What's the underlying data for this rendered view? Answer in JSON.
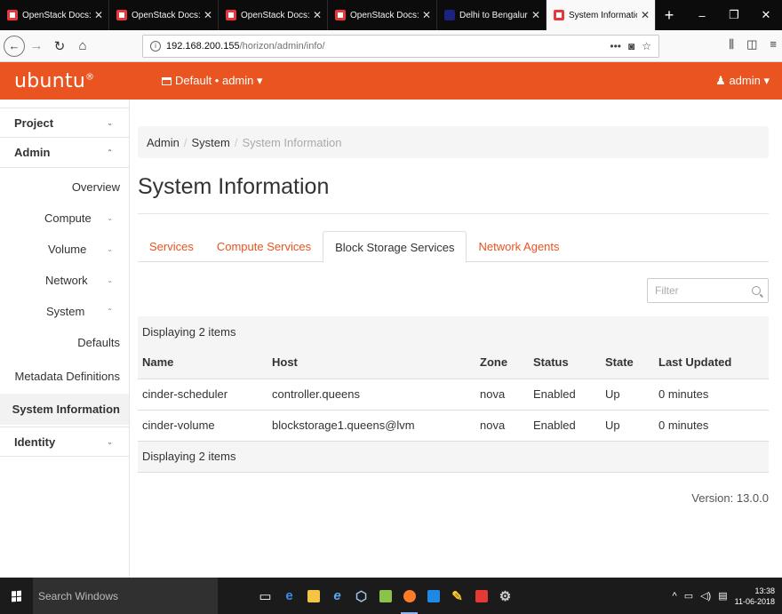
{
  "browser": {
    "tabs": [
      {
        "title": "OpenStack Docs: Etcd for",
        "icon": "openstack-icon",
        "active": false
      },
      {
        "title": "OpenStack Docs: Install C",
        "icon": "openstack-icon",
        "active": false
      },
      {
        "title": "OpenStack Docs: Verify C",
        "icon": "openstack-icon",
        "active": false
      },
      {
        "title": "OpenStack Docs: Install a",
        "icon": "openstack-icon",
        "active": false
      },
      {
        "title": "Delhi to Bengaluru Flight",
        "icon": "airplane-icon",
        "active": false
      },
      {
        "title": "System Information - Op",
        "icon": "openstack-icon",
        "active": true
      }
    ],
    "url_host": "192.168.200.155",
    "url_path": "/horizon/admin/info/"
  },
  "header": {
    "brand": "ubuntu",
    "project_selector": "Default • admin ▾",
    "user_menu": "admin ▾",
    "accent": "#e95420"
  },
  "sidebar": {
    "project": "Project",
    "admin": "Admin",
    "overview": "Overview",
    "compute": "Compute",
    "volume": "Volume",
    "network": "Network",
    "system": "System",
    "defaults": "Defaults",
    "metadata": "Metadata Definitions",
    "system_information": "System Information",
    "identity": "Identity"
  },
  "breadcrumb": [
    "Admin",
    "System",
    "System Information"
  ],
  "page_title": "System Information",
  "tabs": [
    {
      "label": "Services",
      "active": false
    },
    {
      "label": "Compute Services",
      "active": false
    },
    {
      "label": "Block Storage Services",
      "active": true
    },
    {
      "label": "Network Agents",
      "active": false
    }
  ],
  "filter_placeholder": "Filter",
  "table": {
    "caption": "Displaying 2 items",
    "columns": [
      "Name",
      "Host",
      "Zone",
      "Status",
      "State",
      "Last Updated"
    ],
    "rows": [
      [
        "cinder-scheduler",
        "controller.queens",
        "nova",
        "Enabled",
        "Up",
        "0 minutes"
      ],
      [
        "cinder-volume",
        "blockstorage1.queens@lvm",
        "nova",
        "Enabled",
        "Up",
        "0 minutes"
      ]
    ],
    "footer": "Displaying 2 items"
  },
  "version": "Version: 13.0.0",
  "taskbar": {
    "search": "Search Windows",
    "time": "13:38",
    "date": "11-06-2018"
  }
}
